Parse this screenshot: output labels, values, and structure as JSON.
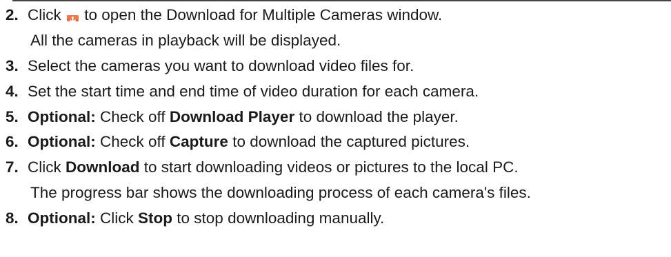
{
  "steps": [
    {
      "number": "2.",
      "text_before_icon": "Click",
      "icon": "download-icon",
      "text_after_icon": "to open the Download for Multiple Cameras window.",
      "note": "All the cameras in playback will be displayed."
    },
    {
      "number": "3.",
      "text": "Select the cameras you want to download video files for."
    },
    {
      "number": "4.",
      "text": "Set the start time and end time of video duration for each camera."
    },
    {
      "number": "5.",
      "optional_label": "Optional:",
      "text_a": "Check off",
      "bold": "Download Player",
      "text_b": "to download the player."
    },
    {
      "number": "6.",
      "optional_label": "Optional:",
      "text_a": "Check off",
      "bold": "Capture",
      "text_b": "to download the captured pictures."
    },
    {
      "number": "7.",
      "text_a": "Click",
      "bold": "Download",
      "text_b": "to start downloading videos or pictures to the local PC.",
      "note": "The progress bar shows the downloading process of each camera's files."
    },
    {
      "number": "8.",
      "optional_label": "Optional:",
      "text_a": "Click",
      "bold": "Stop",
      "text_b": "to stop downloading manually."
    }
  ],
  "colors": {
    "icon_background": "#e8633a",
    "icon_arrow": "#ffffff",
    "text": "#1a1a1a"
  }
}
